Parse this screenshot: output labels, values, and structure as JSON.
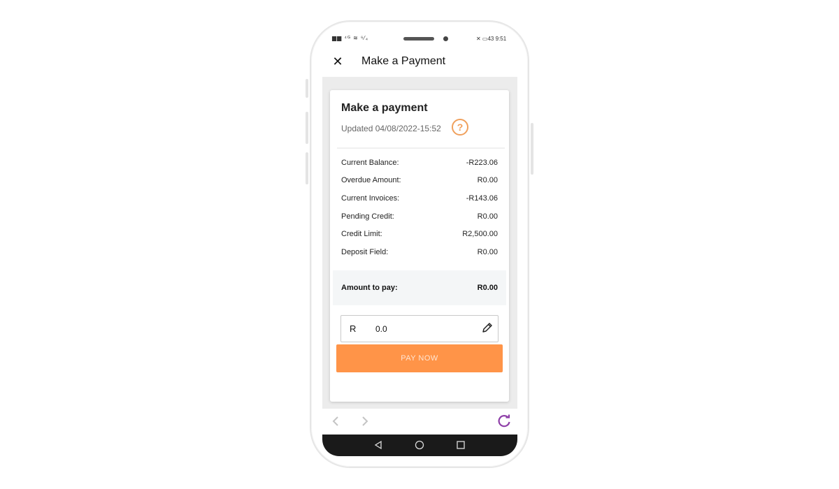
{
  "status_bar": {
    "left": "▆▆ ⁴ᴳ ≋ ⁶⁄₄",
    "right": "✕ ▭43 9:51"
  },
  "app_bar": {
    "close_glyph": "✕",
    "title": "Make a Payment"
  },
  "card": {
    "title": "Make a payment",
    "updated": "Updated 04/08/2022-15:52",
    "help_glyph": "?",
    "rows": [
      {
        "label": "Current Balance:",
        "value": "-R223.06"
      },
      {
        "label": "Overdue Amount:",
        "value": "R0.00"
      },
      {
        "label": "Current Invoices:",
        "value": "-R143.06"
      },
      {
        "label": "Pending Credit:",
        "value": "R0.00"
      },
      {
        "label": "Credit Limit:",
        "value": "R2,500.00"
      },
      {
        "label": "Deposit Field:",
        "value": "R0.00"
      }
    ],
    "amount_to_pay": {
      "label": "Amount to pay:",
      "value": "R0.00"
    },
    "input": {
      "currency": "R",
      "value": "0.0"
    },
    "pay_button": "PAY NOW"
  },
  "colors": {
    "accent": "#ff9448",
    "help_icon": "#f0a05c",
    "refresh_icon": "#8e3fa8"
  },
  "icons": [
    "close-icon",
    "help-icon",
    "pencil-icon",
    "back-arrow-icon",
    "forward-arrow-icon",
    "refresh-icon",
    "android-back-icon",
    "android-home-icon",
    "android-recents-icon"
  ]
}
